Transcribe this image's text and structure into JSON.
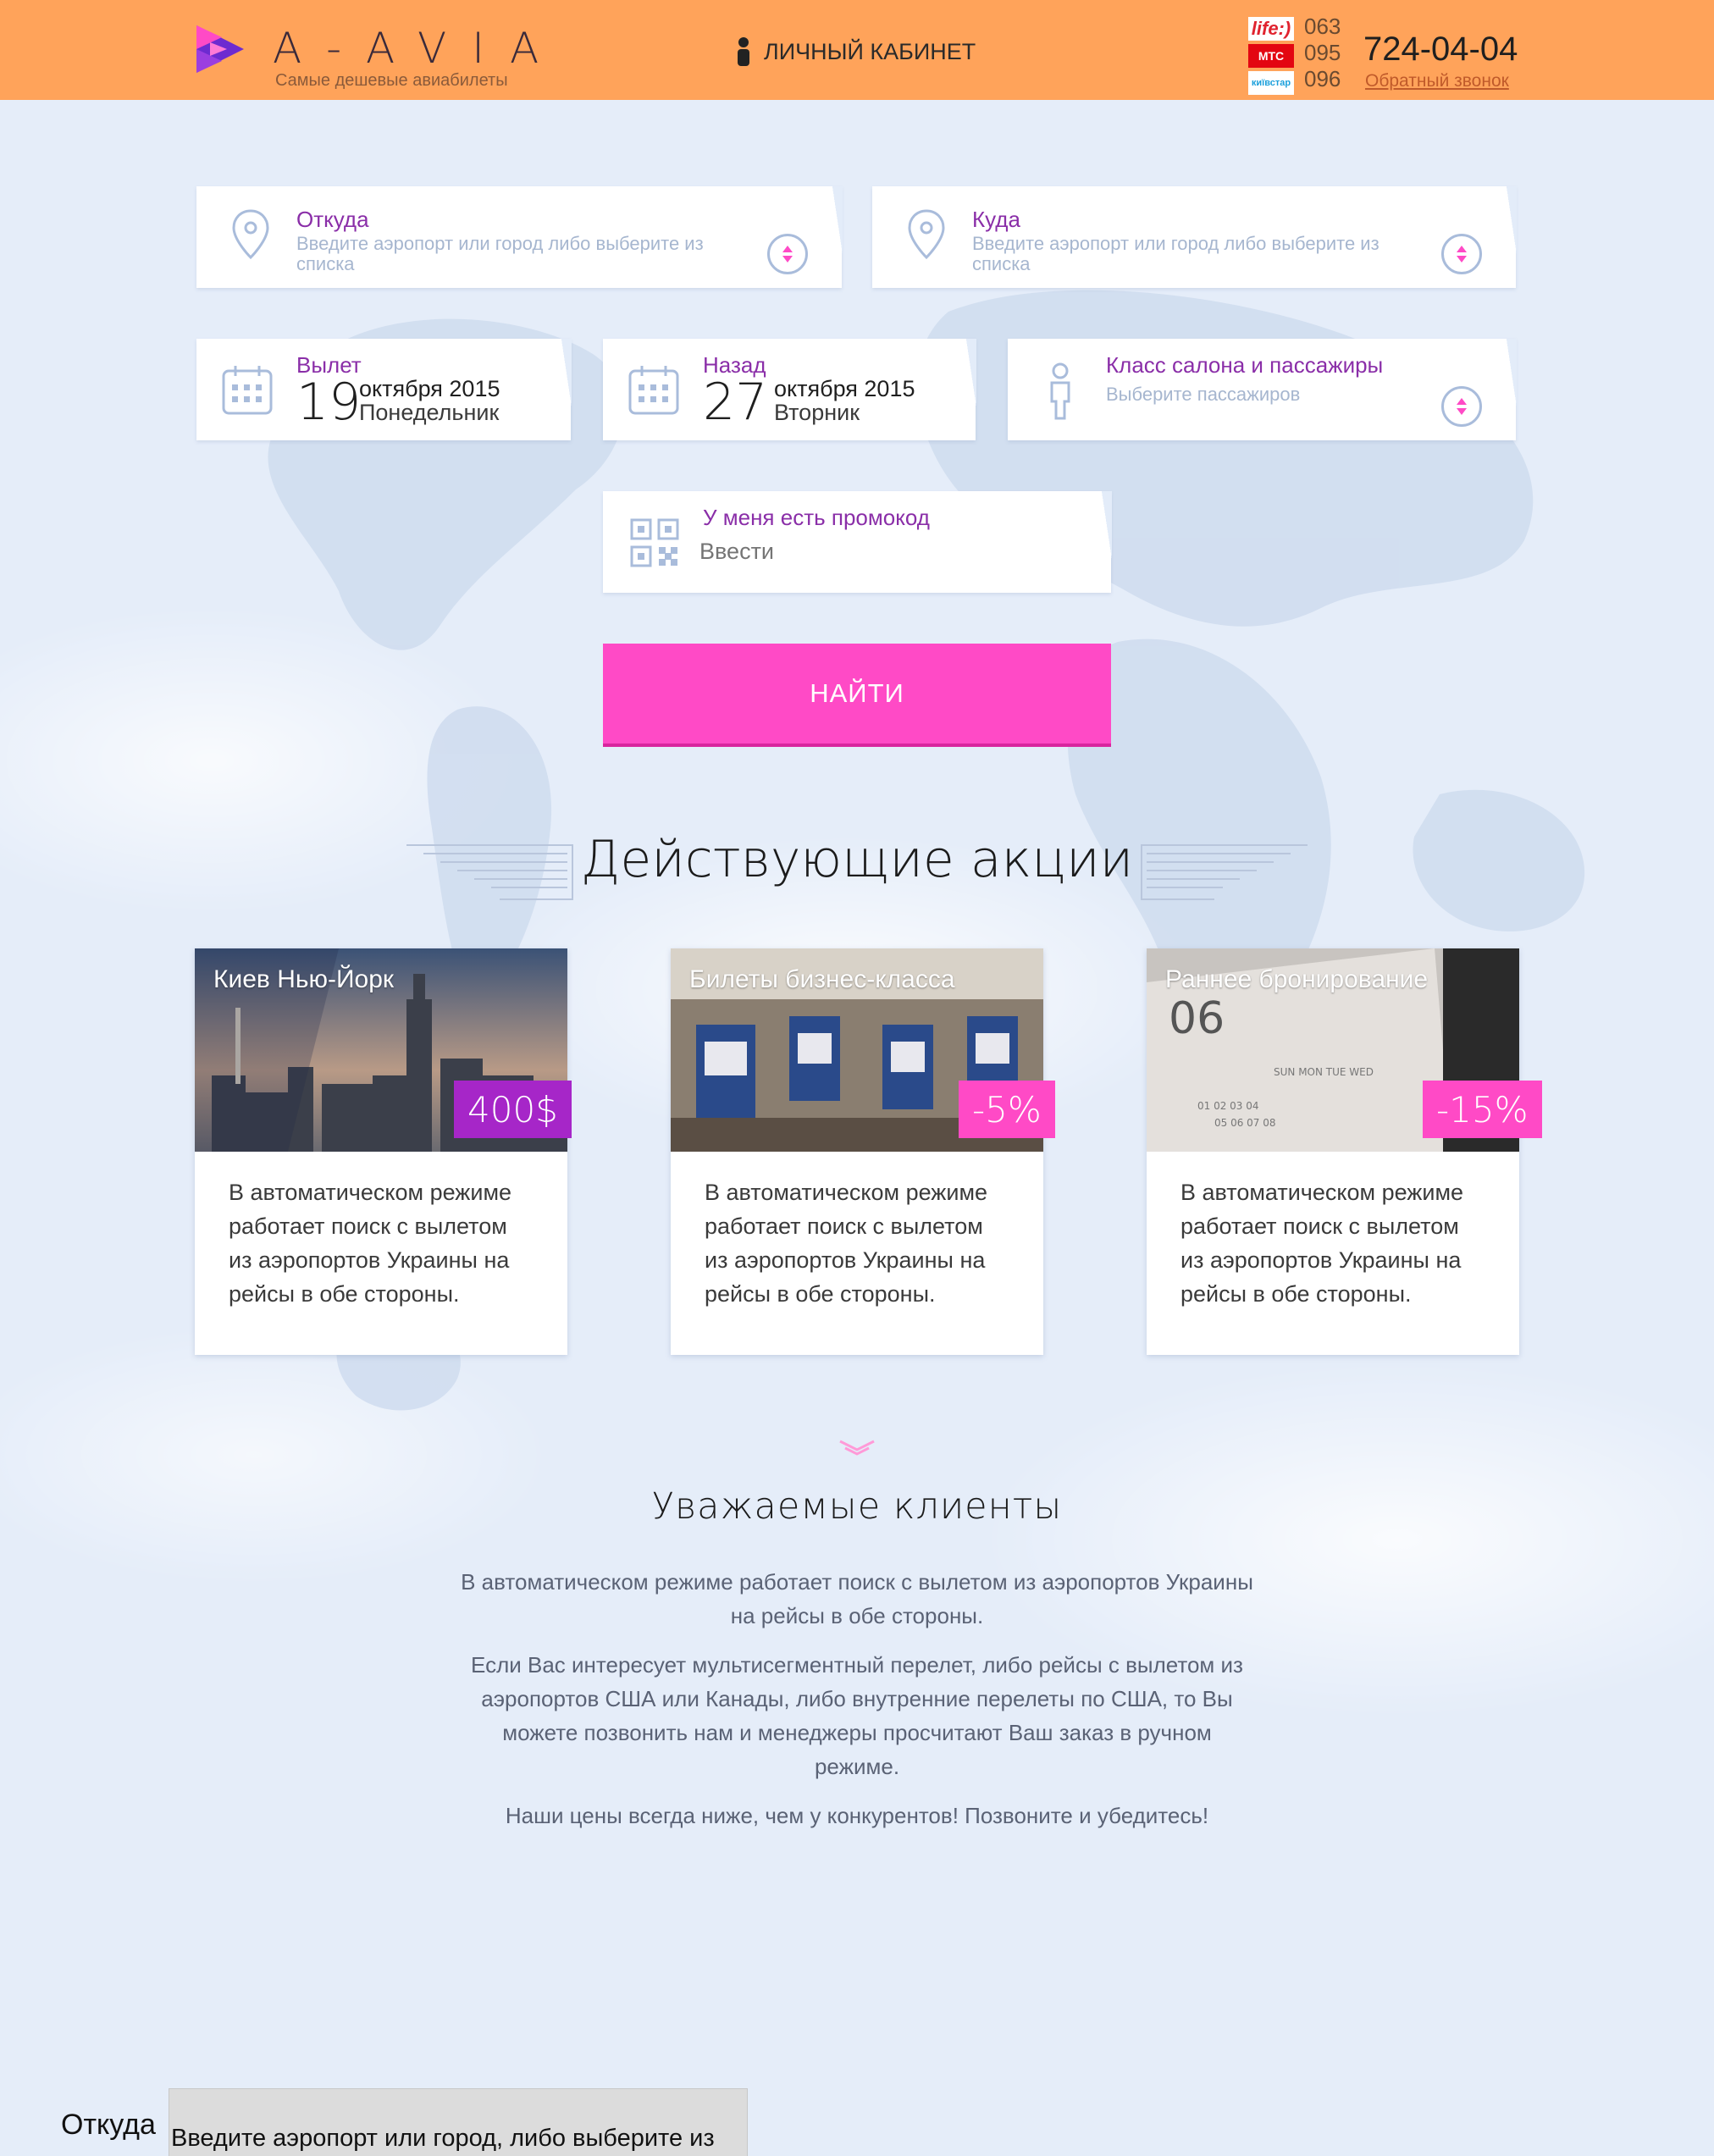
{
  "header": {
    "logo_text": "A-AVIA",
    "logo_subtitle": "Самые дешевые авиабилеты",
    "cabinet_label": "ЛИЧНЫЙ КАБИНЕТ",
    "operators": [
      "life:)",
      "МТС",
      "київстар"
    ],
    "codes": [
      "063",
      "095",
      "096"
    ],
    "phone": "724-04-04",
    "callback": "Обратный звонок"
  },
  "search": {
    "from": {
      "label": "Откуда",
      "placeholder": "Введите аэропорт или город либо выберите из списка"
    },
    "to": {
      "label": "Куда",
      "placeholder": "Введите аэропорт или город либо выберите из списка"
    },
    "depart": {
      "label": "Вылет",
      "day": "19",
      "month": "октября 2015",
      "weekday": "Понедельник"
    },
    "return": {
      "label": "Назад",
      "day": "27",
      "month": "октября 2015",
      "weekday": "Вторник"
    },
    "passengers": {
      "label": "Класс салона и пассажиры",
      "placeholder": "Выберите пассажиров"
    },
    "promo": {
      "label": "У меня есть промокод",
      "placeholder": "Ввести"
    },
    "button": "НАЙТИ"
  },
  "promos": {
    "title": "Действующие акции",
    "items": [
      {
        "title": "Киев  Нью-Йорк",
        "badge": "400$",
        "text": "В автоматическом режиме работает поиск с вылетом из аэропортов Украины на рейсы в обе стороны."
      },
      {
        "title": "Билеты бизнес-класса",
        "badge": "-5%",
        "text": "В автоматическом режиме работает поиск с вылетом из аэропортов Украины на рейсы в обе стороны."
      },
      {
        "title": "Раннее бронирование",
        "badge": "-15%",
        "text": "В автоматическом режиме работает поиск с вылетом из аэропортов Украины на рейсы в обе стороны."
      }
    ]
  },
  "clients": {
    "title": "Уважаемые клиенты",
    "paragraphs": [
      "В автоматическом режиме работает поиск с вылетом из аэропортов Украины на рейсы в обе стороны.",
      "Если Вас интересует мультисегментный перелет, либо рейсы с вылетом из аэропортов США или Канады, либо внутренние перелеты по США, то Вы можете позвонить нам и менеджеры просчитают Ваш заказ в ручном режиме.",
      "Наши цены всегда ниже, чем у конкурентов! Позвоните и убедитесь!"
    ]
  },
  "bottom": {
    "label": "Откуда",
    "placeholder": "Введите аэропорт или город, либо выберите из списка"
  },
  "colors": {
    "header": "#ffa35a",
    "accent_pink": "#ff4ac6",
    "label_purple": "#8a2ea8",
    "badge_purple": "#a626c8",
    "background": "#e3ecf9"
  }
}
